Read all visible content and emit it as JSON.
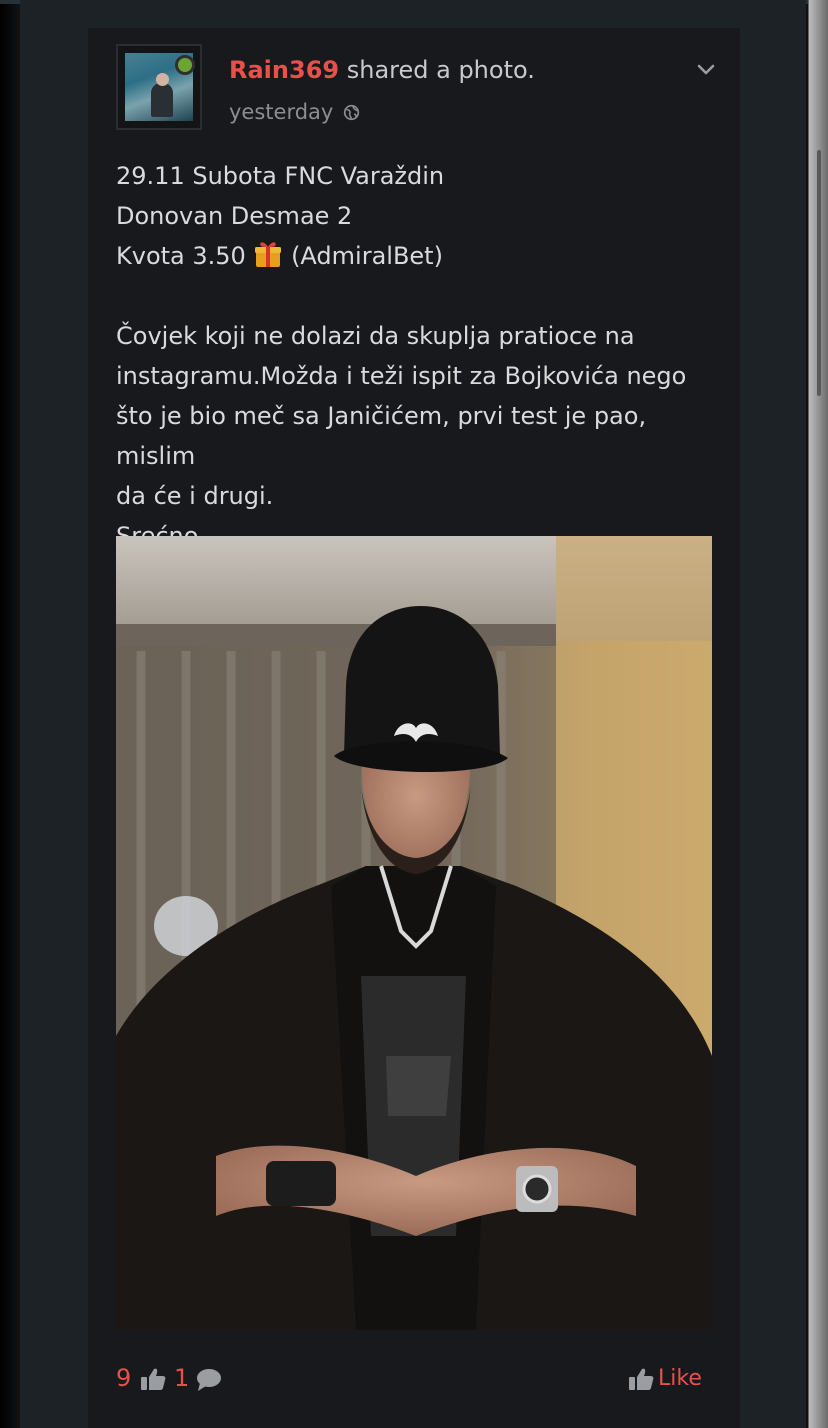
{
  "post": {
    "author": "Rain369",
    "action_text": " shared a photo.",
    "time": "yesterday",
    "privacy_icon": "globe-icon",
    "lines_block1": [
      "29.11 Subota FNC Varaždin",
      "Donovan Desmae 2"
    ],
    "odds_prefix": "Kvota 3.50 ",
    "odds_suffix": " (AdmiralBet)",
    "lines_block2": [
      "Čovjek koji ne dolazi da skuplja pratioce na",
      "instagramu.Možda i teži ispit za Bojkovića nego",
      "što je bio meč sa Janičićem, prvi test je pao, mislim",
      "da će i drugi.",
      "Srećno."
    ]
  },
  "actions": {
    "like_count": "9",
    "comment_count": "1",
    "like_label": "Like"
  },
  "colors": {
    "accent": "#e8504a",
    "card": "#17191c",
    "online": "#6aa632"
  }
}
